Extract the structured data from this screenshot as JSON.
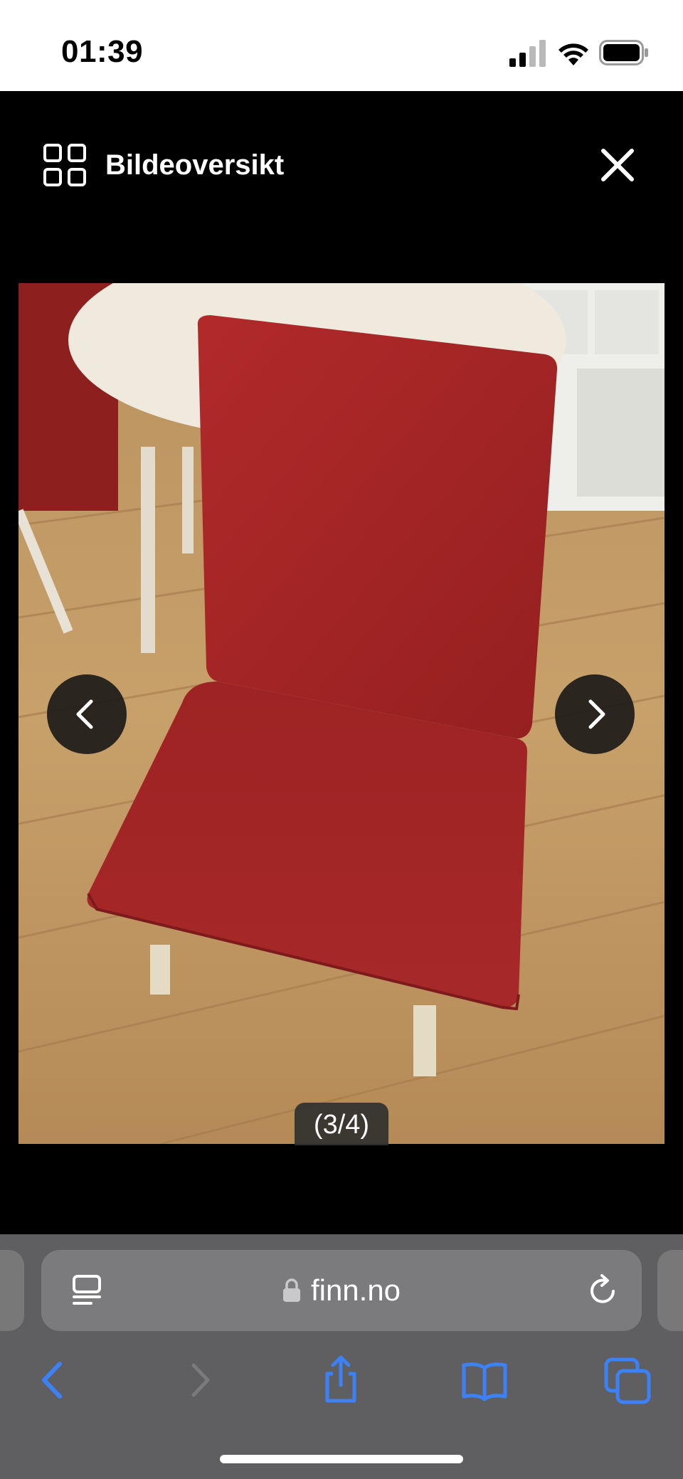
{
  "status_bar": {
    "time": "01:39"
  },
  "viewer": {
    "overview_label": "Bildeoversikt",
    "counter": "(3/4)"
  },
  "browser": {
    "url": "finn.no"
  },
  "colors": {
    "accent": "#3c82f6",
    "chair_red": "#a52626",
    "toolbar_bg": "#5f5f61",
    "url_bar_bg": "#7b7b7d"
  },
  "icons": {
    "overview": "grid-icon",
    "close": "close-icon",
    "prev": "chevron-left-icon",
    "next": "chevron-right-icon",
    "reader": "reader-icon",
    "lock": "lock-icon",
    "reload": "reload-icon",
    "back": "back-arrow-icon",
    "forward": "forward-arrow-icon",
    "share": "share-icon",
    "bookmarks": "bookmarks-icon",
    "tabs": "tabs-icon"
  }
}
